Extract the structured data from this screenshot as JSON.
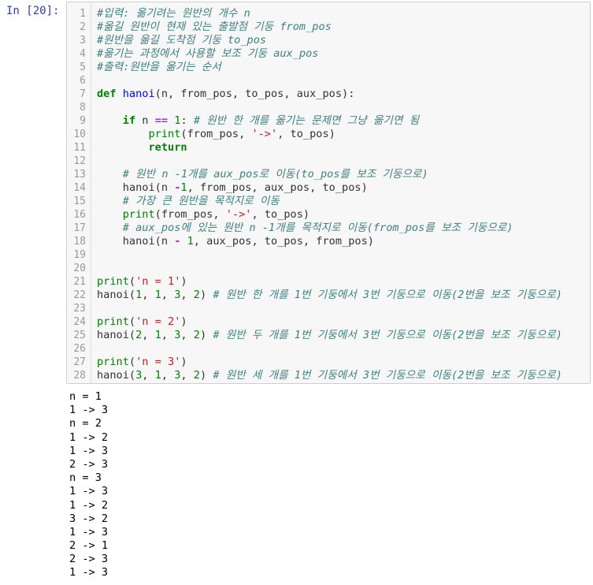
{
  "prompt": "In [20]:",
  "code": [
    {
      "n": "1",
      "segs": [
        {
          "c": "cm",
          "t": "#입력: 옮기려는 원반의 개수 n"
        }
      ]
    },
    {
      "n": "2",
      "segs": [
        {
          "c": "cm",
          "t": "#옮길 원반이 현재 있는 출발점 기둥 from_pos"
        }
      ]
    },
    {
      "n": "3",
      "segs": [
        {
          "c": "cm",
          "t": "#원반을 옮길 도착점 기둥 to_pos"
        }
      ]
    },
    {
      "n": "4",
      "segs": [
        {
          "c": "cm",
          "t": "#옮기는 과정에서 사용할 보조 기둥 aux_pos"
        }
      ]
    },
    {
      "n": "5",
      "segs": [
        {
          "c": "cm",
          "t": "#출력:원반을 옮기는 순서"
        }
      ]
    },
    {
      "n": "6",
      "segs": []
    },
    {
      "n": "7",
      "segs": [
        {
          "c": "kw",
          "t": "def"
        },
        {
          "c": "",
          "t": " "
        },
        {
          "c": "nf",
          "t": "hanoi"
        },
        {
          "c": "",
          "t": "(n, from_pos, to_pos, aux_pos):"
        }
      ]
    },
    {
      "n": "8",
      "segs": []
    },
    {
      "n": "9",
      "segs": [
        {
          "c": "",
          "t": "    "
        },
        {
          "c": "kw",
          "t": "if"
        },
        {
          "c": "",
          "t": " n "
        },
        {
          "c": "op",
          "t": "=="
        },
        {
          "c": "",
          "t": " "
        },
        {
          "c": "mi",
          "t": "1"
        },
        {
          "c": "",
          "t": ": "
        },
        {
          "c": "cm",
          "t": "# 원반 한 개를 옮기는 문제면 그냥 옮기면 됨"
        }
      ]
    },
    {
      "n": "10",
      "segs": [
        {
          "c": "",
          "t": "        "
        },
        {
          "c": "nb",
          "t": "print"
        },
        {
          "c": "",
          "t": "(from_pos, "
        },
        {
          "c": "s",
          "t": "'->'"
        },
        {
          "c": "",
          "t": ", to_pos)"
        }
      ]
    },
    {
      "n": "11",
      "segs": [
        {
          "c": "",
          "t": "        "
        },
        {
          "c": "kw",
          "t": "return"
        }
      ]
    },
    {
      "n": "12",
      "segs": []
    },
    {
      "n": "13",
      "segs": [
        {
          "c": "",
          "t": "    "
        },
        {
          "c": "cm",
          "t": "# 원반 n -1개를 aux_pos로 이동(to_pos를 보조 기둥으로)"
        }
      ]
    },
    {
      "n": "14",
      "segs": [
        {
          "c": "",
          "t": "    hanoi(n "
        },
        {
          "c": "op",
          "t": "-"
        },
        {
          "c": "mi",
          "t": "1"
        },
        {
          "c": "",
          "t": ", from_pos, aux_pos, to_pos)"
        }
      ]
    },
    {
      "n": "15",
      "segs": [
        {
          "c": "",
          "t": "    "
        },
        {
          "c": "cm",
          "t": "# 가장 큰 원반을 목적지로 이동"
        }
      ]
    },
    {
      "n": "16",
      "segs": [
        {
          "c": "",
          "t": "    "
        },
        {
          "c": "nb",
          "t": "print"
        },
        {
          "c": "",
          "t": "(from_pos, "
        },
        {
          "c": "s",
          "t": "'->'"
        },
        {
          "c": "",
          "t": ", to_pos)"
        }
      ]
    },
    {
      "n": "17",
      "segs": [
        {
          "c": "",
          "t": "    "
        },
        {
          "c": "cm",
          "t": "# aux_pos에 있는 원반 n -1개를 목적지로 이동(from_pos를 보조 기둥으로)"
        }
      ]
    },
    {
      "n": "18",
      "segs": [
        {
          "c": "",
          "t": "    hanoi(n "
        },
        {
          "c": "op",
          "t": "-"
        },
        {
          "c": "",
          "t": " "
        },
        {
          "c": "mi",
          "t": "1"
        },
        {
          "c": "",
          "t": ", aux_pos, to_pos, from_pos)"
        }
      ]
    },
    {
      "n": "19",
      "segs": []
    },
    {
      "n": "20",
      "segs": []
    },
    {
      "n": "21",
      "segs": [
        {
          "c": "nb",
          "t": "print"
        },
        {
          "c": "",
          "t": "("
        },
        {
          "c": "s",
          "t": "'n = 1'"
        },
        {
          "c": "",
          "t": ")"
        }
      ]
    },
    {
      "n": "22",
      "segs": [
        {
          "c": "",
          "t": "hanoi("
        },
        {
          "c": "mi",
          "t": "1"
        },
        {
          "c": "",
          "t": ", "
        },
        {
          "c": "mi",
          "t": "1"
        },
        {
          "c": "",
          "t": ", "
        },
        {
          "c": "mi",
          "t": "3"
        },
        {
          "c": "",
          "t": ", "
        },
        {
          "c": "mi",
          "t": "2"
        },
        {
          "c": "",
          "t": ") "
        },
        {
          "c": "cm",
          "t": "# 원반 한 개를 1번 기둥에서 3번 기둥으로 이동(2번을 보조 기둥으로)"
        }
      ]
    },
    {
      "n": "23",
      "segs": []
    },
    {
      "n": "24",
      "segs": [
        {
          "c": "nb",
          "t": "print"
        },
        {
          "c": "",
          "t": "("
        },
        {
          "c": "s",
          "t": "'n = 2'"
        },
        {
          "c": "",
          "t": ")"
        }
      ]
    },
    {
      "n": "25",
      "segs": [
        {
          "c": "",
          "t": "hanoi("
        },
        {
          "c": "mi",
          "t": "2"
        },
        {
          "c": "",
          "t": ", "
        },
        {
          "c": "mi",
          "t": "1"
        },
        {
          "c": "",
          "t": ", "
        },
        {
          "c": "mi",
          "t": "3"
        },
        {
          "c": "",
          "t": ", "
        },
        {
          "c": "mi",
          "t": "2"
        },
        {
          "c": "",
          "t": ") "
        },
        {
          "c": "cm",
          "t": "# 원반 두 개를 1번 기둥에서 3번 기둥으로 이동(2번을 보조 기둥으로)"
        }
      ]
    },
    {
      "n": "26",
      "segs": []
    },
    {
      "n": "27",
      "segs": [
        {
          "c": "nb",
          "t": "print"
        },
        {
          "c": "",
          "t": "("
        },
        {
          "c": "s",
          "t": "'n = 3'"
        },
        {
          "c": "",
          "t": ")"
        }
      ]
    },
    {
      "n": "28",
      "segs": [
        {
          "c": "",
          "t": "hanoi("
        },
        {
          "c": "mi",
          "t": "3"
        },
        {
          "c": "",
          "t": ", "
        },
        {
          "c": "mi",
          "t": "1"
        },
        {
          "c": "",
          "t": ", "
        },
        {
          "c": "mi",
          "t": "3"
        },
        {
          "c": "",
          "t": ", "
        },
        {
          "c": "mi",
          "t": "2"
        },
        {
          "c": "",
          "t": ") "
        },
        {
          "c": "cm",
          "t": "# 원반 세 개를 1번 기둥에서 3번 기둥으로 이동(2번을 보조 기둥으로)"
        }
      ]
    }
  ],
  "output": [
    "n = 1",
    "1 -> 3",
    "n = 2",
    "1 -> 2",
    "1 -> 3",
    "2 -> 3",
    "n = 3",
    "1 -> 3",
    "1 -> 2",
    "3 -> 2",
    "1 -> 3",
    "2 -> 1",
    "2 -> 3",
    "1 -> 3"
  ]
}
